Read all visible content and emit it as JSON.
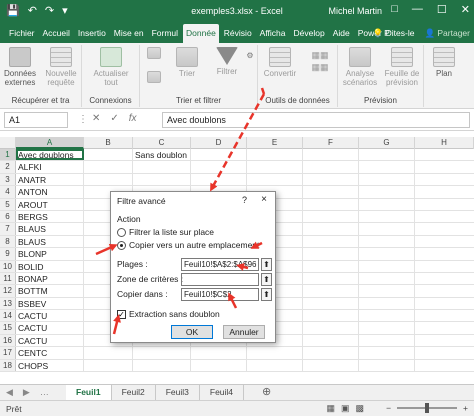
{
  "titlebar": {
    "doc_title": "exemples3.xlsx - Excel",
    "user": "Michel Martin",
    "save_icon": "save-icon",
    "undo_icon": "undo-icon",
    "redo_icon": "redo-icon",
    "customize_icon": "customize-qat-icon"
  },
  "tabs": [
    "Fichier",
    "Accueil",
    "Insertio",
    "Mise en",
    "Formul",
    "Donnée",
    "Révisio",
    "Afficha",
    "Dévelop",
    "Aide",
    "Power P"
  ],
  "active_tab_index": 5,
  "tabs_right": {
    "tell_me": "Dites-le",
    "share": "Partager"
  },
  "ribbon": {
    "groups": [
      {
        "label": "Récupérer et tra",
        "buttons": [
          "Données externes",
          "Nouvelle requête"
        ]
      },
      {
        "label": "Connexions",
        "buttons": [
          "Actualiser tout"
        ]
      },
      {
        "label": "Trier et filtrer",
        "buttons": [
          "Trier",
          "Filtrer"
        ]
      },
      {
        "label": "Outils de données",
        "buttons": [
          "Convertir"
        ]
      },
      {
        "label": "Prévision",
        "buttons": [
          "Analyse scénarios",
          "Feuille de prévision"
        ]
      },
      {
        "label": "",
        "buttons": [
          "Plan"
        ]
      }
    ]
  },
  "formula_bar": {
    "name_box": "A1",
    "content": "Avec doublons"
  },
  "columns": [
    "A",
    "B",
    "C",
    "D",
    "E",
    "F",
    "G",
    "H"
  ],
  "rows": [
    {
      "n": "1",
      "a": "Avec doublons",
      "c": "Sans doublon"
    },
    {
      "n": "2",
      "a": "ALFKI",
      "c": ""
    },
    {
      "n": "3",
      "a": "ANATR",
      "c": ""
    },
    {
      "n": "4",
      "a": "ANTON",
      "c": ""
    },
    {
      "n": "5",
      "a": "AROUT",
      "c": ""
    },
    {
      "n": "6",
      "a": "BERGS",
      "c": ""
    },
    {
      "n": "7",
      "a": "BLAUS",
      "c": ""
    },
    {
      "n": "8",
      "a": "BLAUS",
      "c": ""
    },
    {
      "n": "9",
      "a": "BLONP",
      "c": ""
    },
    {
      "n": "10",
      "a": "BOLID",
      "c": ""
    },
    {
      "n": "11",
      "a": "BONAP",
      "c": ""
    },
    {
      "n": "12",
      "a": "BOTTM",
      "c": ""
    },
    {
      "n": "13",
      "a": "BSBEV",
      "c": ""
    },
    {
      "n": "14",
      "a": "CACTU",
      "c": ""
    },
    {
      "n": "15",
      "a": "CACTU",
      "c": ""
    },
    {
      "n": "16",
      "a": "CACTU",
      "c": ""
    },
    {
      "n": "17",
      "a": "CENTC",
      "c": ""
    },
    {
      "n": "18",
      "a": "CHOPS",
      "c": ""
    }
  ],
  "dialog": {
    "title": "Filtre avancé",
    "help": "?",
    "close": "×",
    "section": "Action",
    "radio1": "Filtrer la liste sur place",
    "radio2": "Copier vers un autre emplacement",
    "selected_radio": 2,
    "plages_label": "Plages :",
    "plages_value": "Feuil10!$A$2:$A$96",
    "criteres_label": "Zone de critères :",
    "criteres_value": "",
    "copier_label": "Copier dans :",
    "copier_value": "Feuil10!$C$2",
    "checkbox_label": "Extraction sans doublon",
    "checkbox_checked": true,
    "ok": "OK",
    "cancel": "Annuler"
  },
  "sheets": [
    "Feuil1",
    "Feuil2",
    "Feuil3",
    "Feuil4"
  ],
  "active_sheet_index": 0,
  "status": {
    "ready": "Prêt"
  },
  "colors": {
    "excel_green": "#217346",
    "arrow_red": "#e8342a"
  }
}
